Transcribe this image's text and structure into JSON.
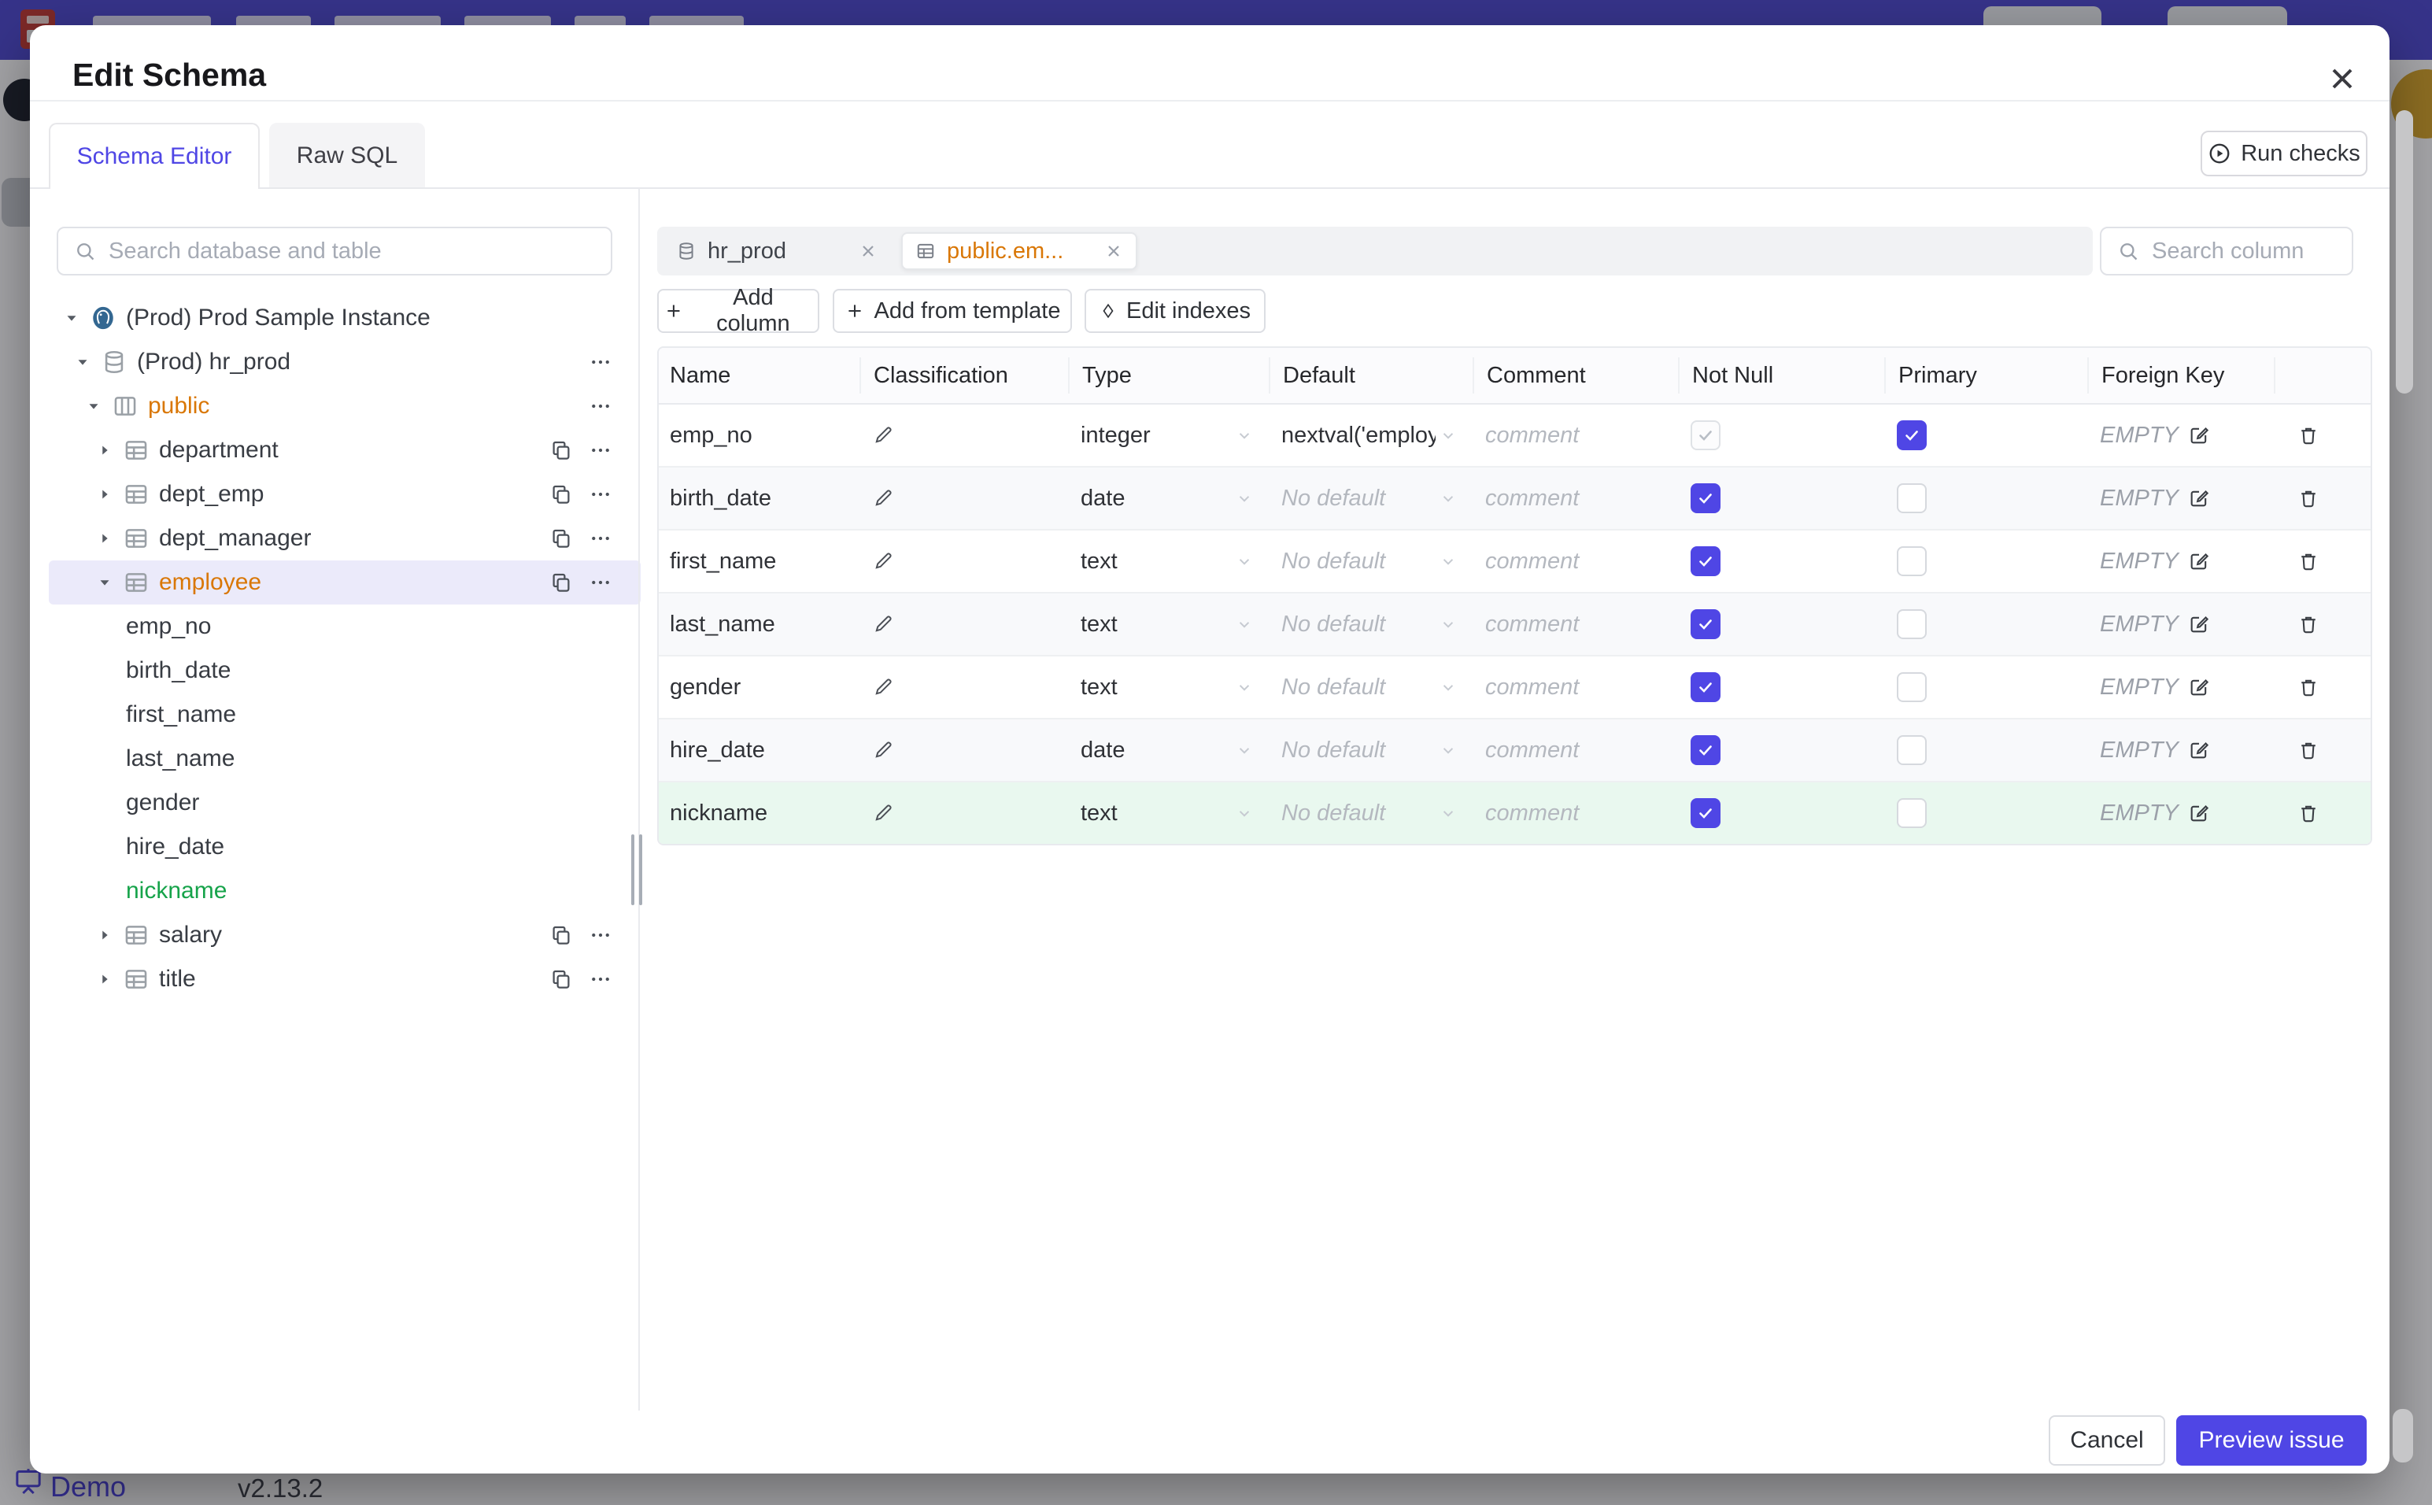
{
  "page": {
    "behind_footer": {
      "demo_label": "Demo",
      "version": "v2.13.2"
    }
  },
  "modal": {
    "title": "Edit Schema",
    "tabs": [
      {
        "label": "Schema Editor",
        "active": true
      },
      {
        "label": "Raw SQL",
        "active": false
      }
    ],
    "run_checks_label": "Run checks",
    "footer": {
      "cancel_label": "Cancel",
      "submit_label": "Preview issue"
    }
  },
  "sidebar": {
    "search_placeholder": "Search database and table",
    "tree": [
      {
        "label": "(Prod) Prod Sample Instance",
        "level": 0,
        "icon": "postgres",
        "caret": "down"
      },
      {
        "label": "(Prod) hr_prod",
        "level": 1,
        "icon": "database",
        "caret": "down",
        "more": true
      },
      {
        "label": "public",
        "level": 2,
        "icon": "schema",
        "caret": "down",
        "more": true,
        "highlight": "orange"
      },
      {
        "label": "department",
        "level": 3,
        "icon": "table",
        "caret": "right",
        "copy": true,
        "more": true
      },
      {
        "label": "dept_emp",
        "level": 3,
        "icon": "table",
        "caret": "right",
        "copy": true,
        "more": true
      },
      {
        "label": "dept_manager",
        "level": 3,
        "icon": "table",
        "caret": "right",
        "copy": true,
        "more": true
      },
      {
        "label": "employee",
        "level": 3,
        "icon": "table",
        "caret": "down",
        "copy": true,
        "more": true,
        "highlight": "orange",
        "selected": true
      },
      {
        "label": "emp_no",
        "level": 4,
        "column": true
      },
      {
        "label": "birth_date",
        "level": 4,
        "column": true
      },
      {
        "label": "first_name",
        "level": 4,
        "column": true
      },
      {
        "label": "last_name",
        "level": 4,
        "column": true
      },
      {
        "label": "gender",
        "level": 4,
        "column": true
      },
      {
        "label": "hire_date",
        "level": 4,
        "column": true
      },
      {
        "label": "nickname",
        "level": 4,
        "column": true,
        "highlight": "green"
      },
      {
        "label": "salary",
        "level": 3,
        "icon": "table",
        "caret": "right",
        "copy": true,
        "more": true
      },
      {
        "label": "title",
        "level": 3,
        "icon": "table",
        "caret": "right",
        "copy": true,
        "more": true
      }
    ]
  },
  "editor": {
    "chips": [
      {
        "label": "hr_prod",
        "icon": "database",
        "active": false
      },
      {
        "label": "public.em...",
        "icon": "table",
        "active": true
      }
    ],
    "search_placeholder": "Search column",
    "actions": [
      {
        "label": "Add column",
        "icon": "plus"
      },
      {
        "label": "Add from template",
        "icon": "plus"
      },
      {
        "label": "Edit indexes",
        "icon": "diamond"
      }
    ],
    "table": {
      "headers": [
        "Name",
        "Classification",
        "Type",
        "Default",
        "Comment",
        "Not Null",
        "Primary",
        "Foreign Key"
      ],
      "comment_placeholder": "comment",
      "default_placeholder": "No default",
      "foreign_key_placeholder": "EMPTY",
      "rows": [
        {
          "name": "emp_no",
          "type": "integer",
          "default": "nextval('employ",
          "default_is_placeholder": false,
          "not_null": true,
          "not_null_disabled": true,
          "primary": true,
          "state": "normal"
        },
        {
          "name": "birth_date",
          "type": "date",
          "default": "No default",
          "default_is_placeholder": true,
          "not_null": true,
          "not_null_disabled": false,
          "primary": false,
          "state": "normal"
        },
        {
          "name": "first_name",
          "type": "text",
          "default": "No default",
          "default_is_placeholder": true,
          "not_null": true,
          "not_null_disabled": false,
          "primary": false,
          "state": "normal"
        },
        {
          "name": "last_name",
          "type": "text",
          "default": "No default",
          "default_is_placeholder": true,
          "not_null": true,
          "not_null_disabled": false,
          "primary": false,
          "state": "normal"
        },
        {
          "name": "gender",
          "type": "text",
          "default": "No default",
          "default_is_placeholder": true,
          "not_null": true,
          "not_null_disabled": false,
          "primary": false,
          "state": "normal"
        },
        {
          "name": "hire_date",
          "type": "date",
          "default": "No default",
          "default_is_placeholder": true,
          "not_null": true,
          "not_null_disabled": false,
          "primary": false,
          "state": "normal"
        },
        {
          "name": "nickname",
          "type": "text",
          "default": "No default",
          "default_is_placeholder": true,
          "not_null": true,
          "not_null_disabled": false,
          "primary": false,
          "state": "new"
        }
      ]
    }
  },
  "colors": {
    "accent": "#4f46e5",
    "changed": "#d97706",
    "added": "#16a34a"
  }
}
